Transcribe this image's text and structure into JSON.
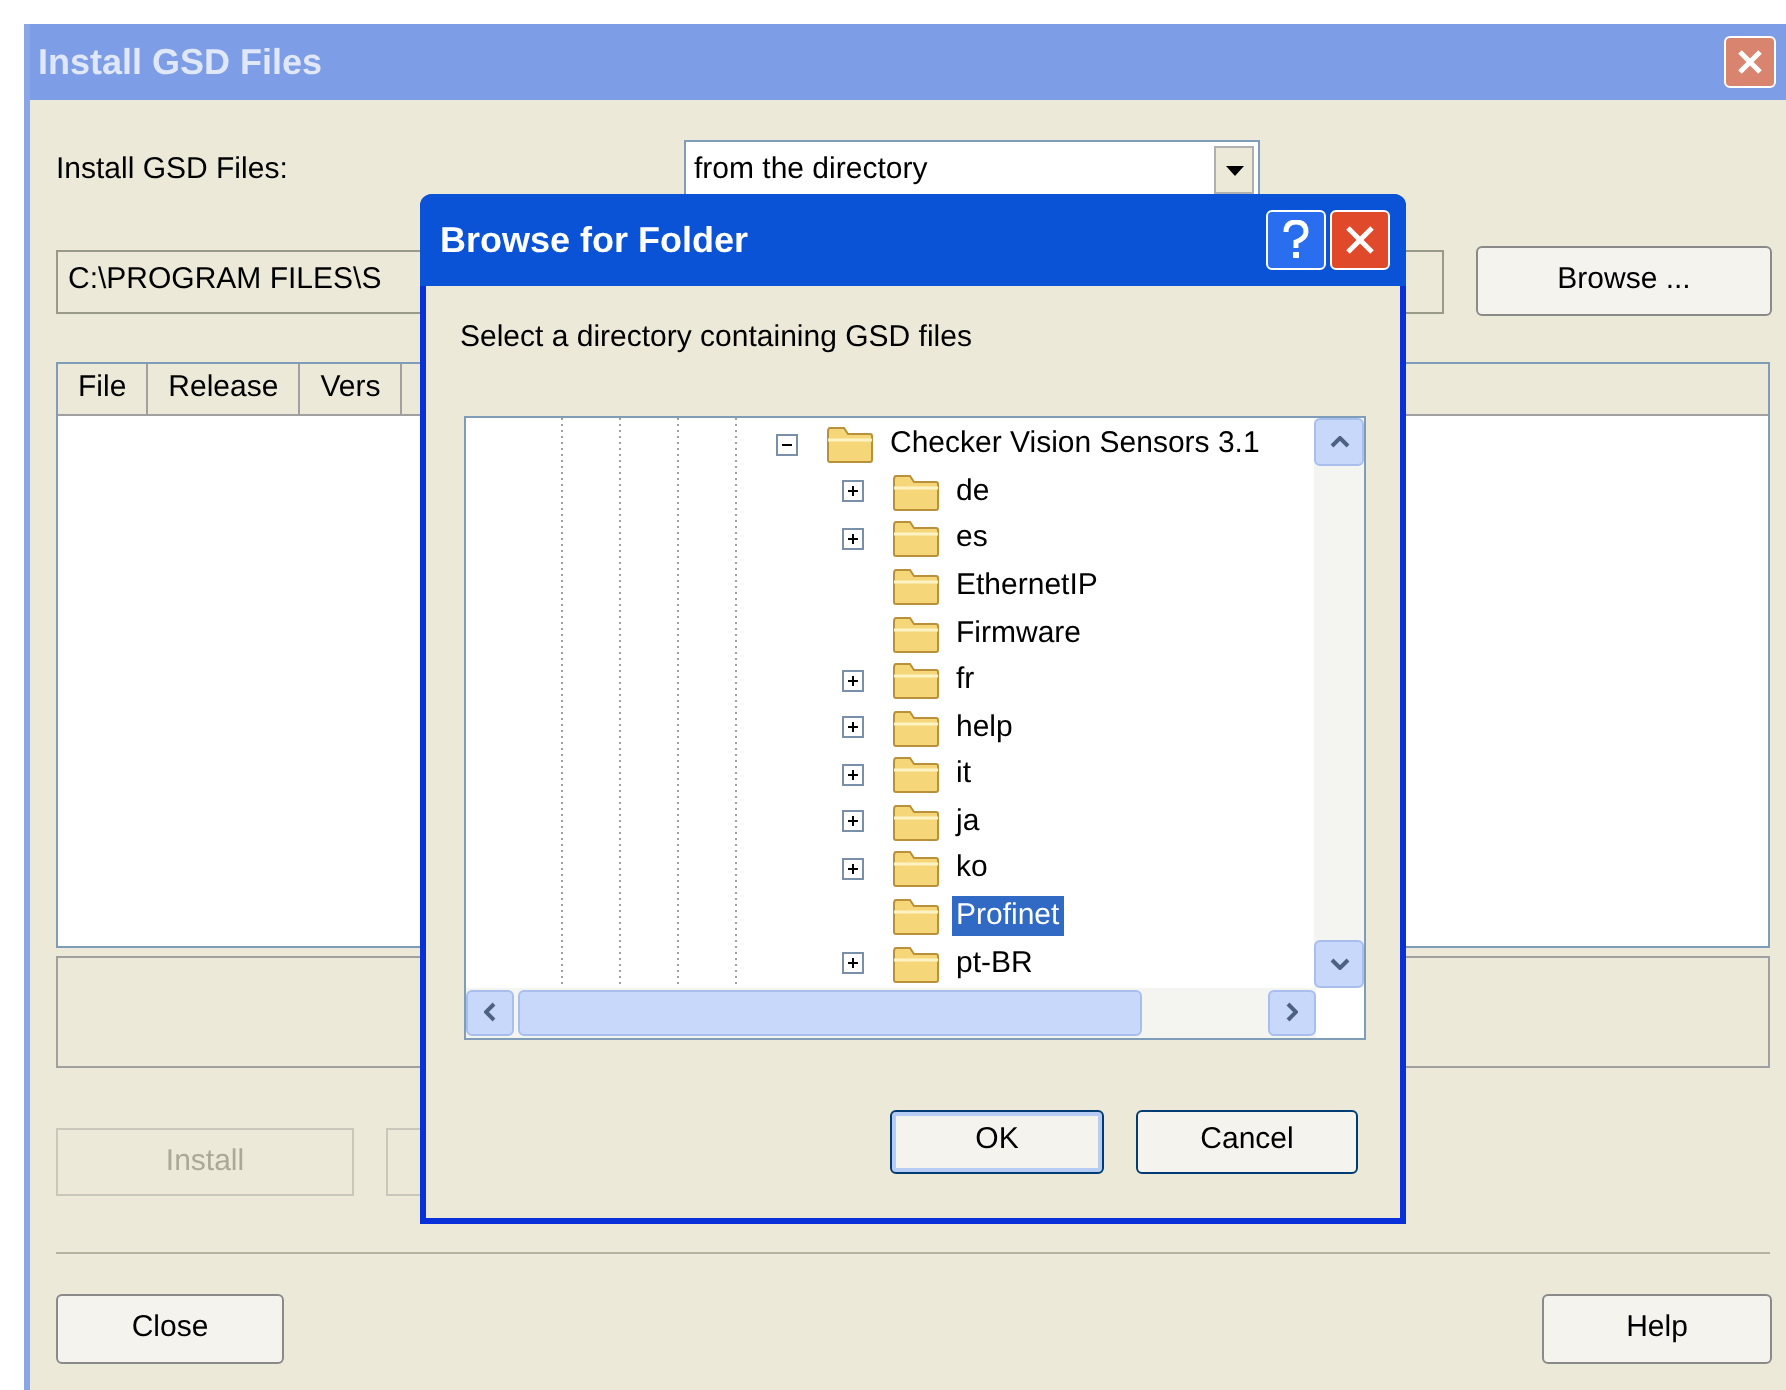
{
  "window": {
    "title": "Install GSD Files",
    "active": false
  },
  "source": {
    "label": "Install GSD Files:",
    "value": "from the directory"
  },
  "path": {
    "value": "C:\\PROGRAM FILES\\S"
  },
  "browse_button": {
    "label": "Browse ..."
  },
  "file_list": {
    "columns": [
      "File",
      "Release",
      "Vers"
    ]
  },
  "install_button": {
    "label": "Install",
    "disabled": true
  },
  "close_button": {
    "label": "Close"
  },
  "help_button": {
    "label": "Help"
  },
  "dialog": {
    "title": "Browse for Folder",
    "active": true,
    "instruction": "Select a directory containing GSD files",
    "tree": [
      {
        "label": "Checker Vision Sensors 3.1",
        "expanded": true,
        "has_children": true,
        "selected": false,
        "children": [
          {
            "label": "de",
            "has_children": true,
            "selected": false
          },
          {
            "label": "es",
            "has_children": true,
            "selected": false
          },
          {
            "label": "EthernetIP",
            "has_children": false,
            "selected": false
          },
          {
            "label": "Firmware",
            "has_children": false,
            "selected": false
          },
          {
            "label": "fr",
            "has_children": true,
            "selected": false
          },
          {
            "label": "help",
            "has_children": true,
            "selected": false
          },
          {
            "label": "it",
            "has_children": true,
            "selected": false
          },
          {
            "label": "ja",
            "has_children": true,
            "selected": false
          },
          {
            "label": "ko",
            "has_children": true,
            "selected": false
          },
          {
            "label": "Profinet",
            "has_children": false,
            "selected": true
          },
          {
            "label": "pt-BR",
            "has_children": true,
            "selected": false
          }
        ]
      }
    ],
    "ok_button": {
      "label": "OK"
    },
    "cancel_button": {
      "label": "Cancel"
    }
  }
}
